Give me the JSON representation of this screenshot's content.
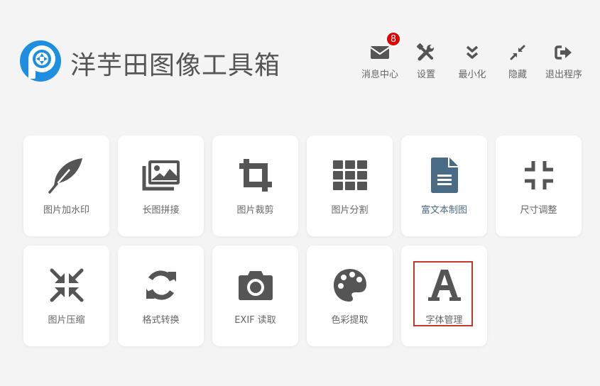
{
  "app": {
    "title": "洋芋田图像工具箱"
  },
  "toolbar": {
    "items": [
      {
        "label": "消息中心",
        "icon": "envelope-icon",
        "badge": "8"
      },
      {
        "label": "设置",
        "icon": "wrench-screwdriver-icon"
      },
      {
        "label": "最小化",
        "icon": "double-chevron-down-icon"
      },
      {
        "label": "隐藏",
        "icon": "compress-arrows-icon"
      },
      {
        "label": "退出程序",
        "icon": "sign-out-icon"
      }
    ]
  },
  "tools": [
    {
      "label": "图片加水印",
      "icon": "feather-icon"
    },
    {
      "label": "长图拼接",
      "icon": "images-icon"
    },
    {
      "label": "图片裁剪",
      "icon": "crop-icon"
    },
    {
      "label": "图片分割",
      "icon": "grid-icon"
    },
    {
      "label": "富文本制图",
      "icon": "document-icon"
    },
    {
      "label": "尺寸调整",
      "icon": "compress-icon"
    },
    {
      "label": "图片压缩",
      "icon": "compress-arrows-in-icon"
    },
    {
      "label": "格式转换",
      "icon": "sync-icon"
    },
    {
      "label": "EXIF 读取",
      "icon": "camera-icon"
    },
    {
      "label": "色彩提取",
      "icon": "palette-icon"
    },
    {
      "label": "字体管理",
      "icon": "font-icon"
    }
  ],
  "colors": {
    "background": "#f4f4f4",
    "icon": "#555555",
    "accent_icon": "#4a6b86",
    "badge": "#e00000",
    "logo_blue": "#1e8fe0",
    "selection": "#c0392b"
  }
}
